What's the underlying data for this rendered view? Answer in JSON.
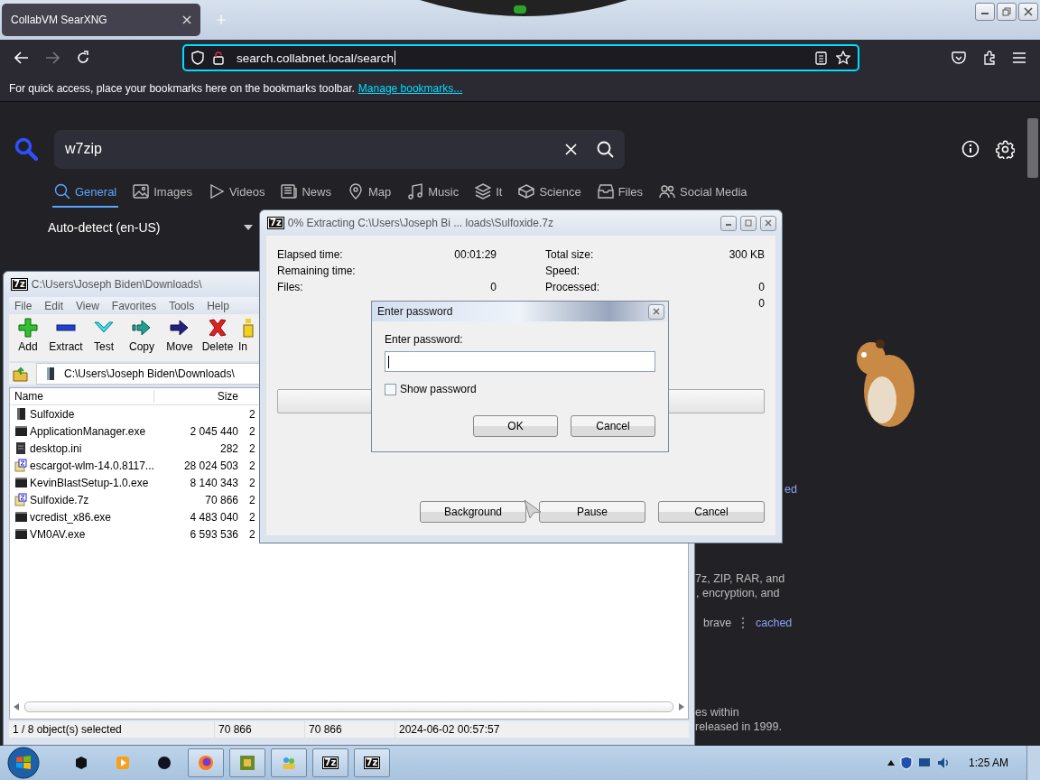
{
  "browser": {
    "tabs": [
      {
        "title": "CollabVM SearXNG",
        "selected": true
      }
    ],
    "url": "search.collabnet.local/search",
    "bookmarks_hint": "For quick access, place your bookmarks here on the bookmarks toolbar.",
    "bookmarks_link": "Manage bookmarks..."
  },
  "search": {
    "query": "w7zip",
    "categories": [
      {
        "label": "General",
        "kind": "general",
        "selected": true
      },
      {
        "label": "Images",
        "kind": "images",
        "selected": false
      },
      {
        "label": "Videos",
        "kind": "videos",
        "selected": false
      },
      {
        "label": "News",
        "kind": "news",
        "selected": false
      },
      {
        "label": "Map",
        "kind": "map",
        "selected": false
      },
      {
        "label": "Music",
        "kind": "music",
        "selected": false
      },
      {
        "label": "It",
        "kind": "it",
        "selected": false
      },
      {
        "label": "Science",
        "kind": "science",
        "selected": false
      },
      {
        "label": "Files",
        "kind": "files",
        "selected": false
      },
      {
        "label": "Social Media",
        "kind": "social",
        "selected": false
      }
    ],
    "language": "Auto-detect (en-US)",
    "fragments": [
      {
        "text": "ed",
        "kind": "link"
      },
      {
        "text": "7z, ZIP, RAR, and",
        "kind": "text"
      },
      {
        "text": ", encryption, and",
        "kind": "text"
      },
      {
        "text": "brave",
        "kind": "text"
      },
      {
        "text": "cached",
        "kind": "link"
      },
      {
        "text": "es within",
        "kind": "text"
      },
      {
        "text": "released in 1999.",
        "kind": "text"
      }
    ]
  },
  "file_manager": {
    "icon_text": "7z",
    "title": "C:\\Users\\Joseph Biden\\Downloads\\",
    "menu": [
      "File",
      "Edit",
      "View",
      "Favorites",
      "Tools",
      "Help"
    ],
    "toolbar": [
      {
        "label": "Add",
        "kind": "add"
      },
      {
        "label": "Extract",
        "kind": "extract"
      },
      {
        "label": "Test",
        "kind": "test"
      },
      {
        "label": "Copy",
        "kind": "copy"
      },
      {
        "label": "Move",
        "kind": "move"
      },
      {
        "label": "Delete",
        "kind": "delete"
      },
      {
        "label": "In",
        "kind": "info"
      }
    ],
    "path": "C:\\Users\\Joseph Biden\\Downloads\\",
    "columns": [
      "Name",
      "Size"
    ],
    "rows": [
      {
        "name": "Sulfoxide",
        "size": "",
        "column_3": "2",
        "kind": "folder"
      },
      {
        "name": "ApplicationManager.exe",
        "size": "2 045 440",
        "column_3": "2",
        "kind": "exe"
      },
      {
        "name": "desktop.ini",
        "size": "282",
        "column_3": "2",
        "kind": "ini"
      },
      {
        "name": "escargot-wlm-14.0.8117...",
        "size": "28 024 503",
        "column_3": "2",
        "kind": "archive"
      },
      {
        "name": "KevinBlastSetup-1.0.exe",
        "size": "8 140 343",
        "column_3": "2",
        "kind": "exe"
      },
      {
        "name": "Sulfoxide.7z",
        "size": "70 866",
        "column_3": "2",
        "kind": "archive"
      },
      {
        "name": "vcredist_x86.exe",
        "size": "4 483 040",
        "column_3": "2",
        "kind": "exe"
      },
      {
        "name": "VM0AV.exe",
        "size": "6 593 536",
        "column_3": "2",
        "kind": "exe"
      }
    ],
    "status": [
      "1 / 8 object(s) selected",
      "70 866",
      "70 866",
      "2024-06-02 00:57:57"
    ]
  },
  "extract_dialog": {
    "icon_text": "7z",
    "title": "0% Extracting C:\\Users\\Joseph Bi ... loads\\Sulfoxide.7z",
    "left": [
      {
        "label": "Elapsed time:",
        "value": "00:01:29"
      },
      {
        "label": "Remaining time:"
      },
      {
        "label": "Files:",
        "value": "0"
      }
    ],
    "right": [
      {
        "label": "Total size:",
        "value": "300 KB"
      },
      {
        "label": "Speed:"
      },
      {
        "label": "Processed:",
        "value": "0"
      },
      {
        "value": "0"
      }
    ],
    "progress": {
      "level": 0
    },
    "buttons": [
      "Background",
      "Pause",
      "Cancel"
    ]
  },
  "password_dialog": {
    "title": "Enter password",
    "prompt": "Enter password:",
    "show_password": {
      "label": "Show password",
      "checked": false
    },
    "buttons": [
      "OK",
      "Cancel"
    ]
  },
  "taskbar": {
    "windows": [
      {
        "badge": "7z"
      },
      {
        "badge": "7z"
      }
    ],
    "clock": "1:25 AM"
  }
}
